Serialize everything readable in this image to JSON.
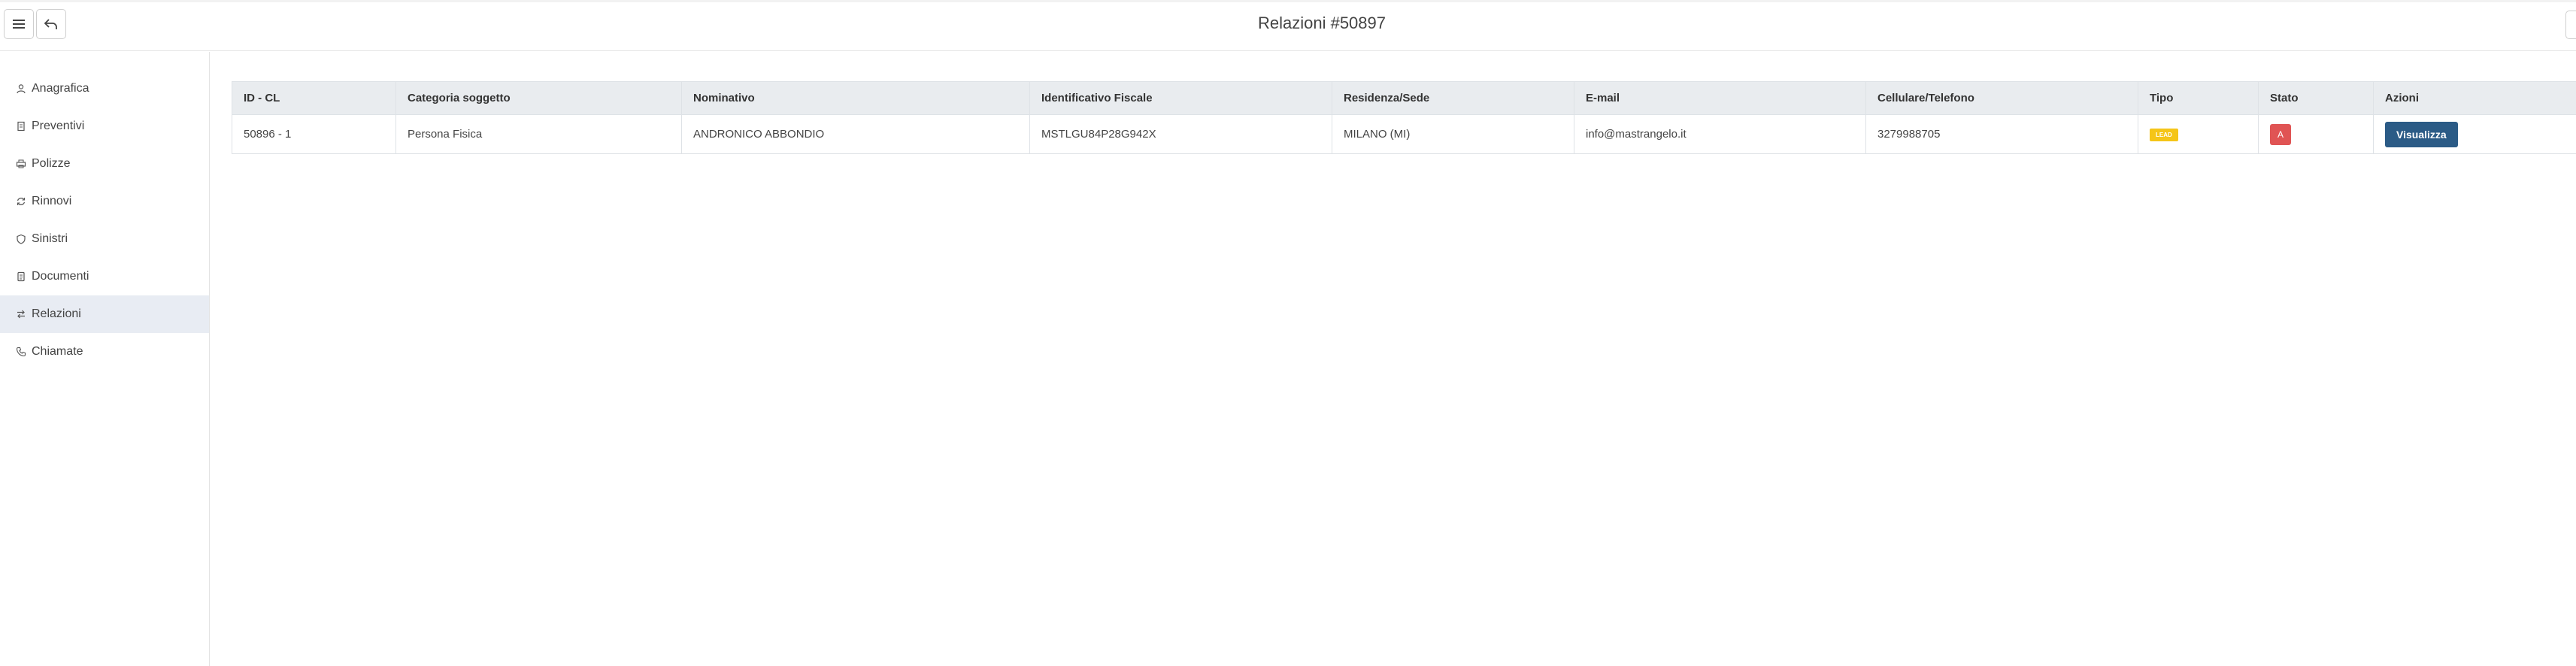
{
  "header": {
    "title": "Relazioni #50897"
  },
  "sidebar": {
    "items": [
      {
        "label": "Anagrafica",
        "icon": "user-icon"
      },
      {
        "label": "Preventivi",
        "icon": "document-icon"
      },
      {
        "label": "Polizze",
        "icon": "printer-icon"
      },
      {
        "label": "Rinnovi",
        "icon": "refresh-icon"
      },
      {
        "label": "Sinistri",
        "icon": "shield-icon"
      },
      {
        "label": "Documenti",
        "icon": "file-icon"
      },
      {
        "label": "Relazioni",
        "icon": "arrows-swap-icon",
        "active": true
      },
      {
        "label": "Chiamate",
        "icon": "phone-icon"
      }
    ]
  },
  "table": {
    "headers": [
      "ID - CL",
      "Categoria soggetto",
      "Nominativo",
      "Identificativo Fiscale",
      "Residenza/Sede",
      "E-mail",
      "Cellulare/Telefono",
      "Tipo",
      "Stato",
      "Azioni"
    ],
    "rows": [
      {
        "id": "50896 - 1",
        "categoria": "Persona Fisica",
        "nominativo": "ANDRONICO ABBONDIO",
        "fiscale": "MSTLGU84P28G942X",
        "residenza": "MILANO (MI)",
        "email": "info@mastrangelo.it",
        "telefono": "3279988705",
        "tipo": "LEAD",
        "stato": "A",
        "azione": "Visualizza"
      }
    ]
  },
  "colors": {
    "accent": "#2b5b86",
    "lead": "#f5c518",
    "stato": "#e05454",
    "active_bg": "#e8ecf3"
  }
}
